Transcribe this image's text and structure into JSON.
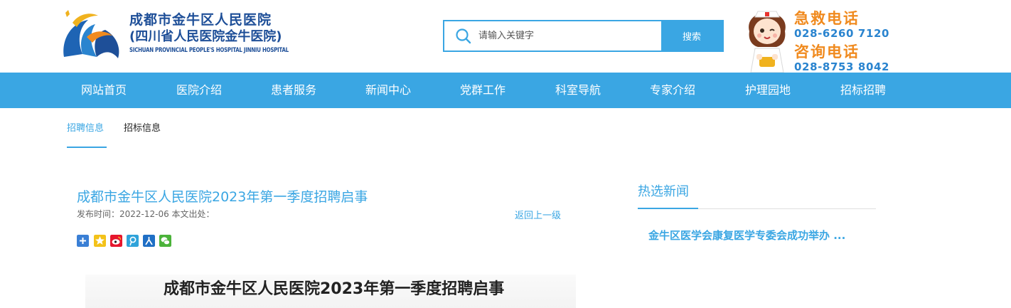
{
  "header": {
    "hospital_name_cn": "成都市金牛区人民医院",
    "hospital_name_cn_sub": "(四川省人民医院金牛医院)",
    "hospital_name_en": "SICHUAN PROVINCIAL PEOPLE'S HOSPITAL JINNIU HOSPITAL",
    "search": {
      "placeholder": "请输入关键字",
      "button_label": "搜索"
    },
    "emergency": {
      "label": "急救电话",
      "number": "028-6260 7120"
    },
    "consult": {
      "label": "咨询电话",
      "number": "028-8753 8042"
    }
  },
  "nav": {
    "items": [
      {
        "label": "网站首页"
      },
      {
        "label": "医院介绍"
      },
      {
        "label": "患者服务"
      },
      {
        "label": "新闻中心"
      },
      {
        "label": "党群工作"
      },
      {
        "label": "科室导航"
      },
      {
        "label": "专家介绍"
      },
      {
        "label": "护理园地"
      },
      {
        "label": "招标招聘"
      }
    ]
  },
  "subtabs": [
    {
      "label": "招聘信息",
      "active": true
    },
    {
      "label": "招标信息",
      "active": false
    }
  ],
  "article": {
    "title": "成都市金牛区人民医院2023年第一季度招聘启事",
    "meta": "发布时间：2022-12-06 本文出处：",
    "back_label": "返回上一级",
    "heading": "成都市金牛区人民医院2023年第一季度招聘启事",
    "share_icons": [
      "share-more-icon",
      "qzone-icon",
      "weibo-icon",
      "tencent-icon",
      "renren-icon",
      "wechat-icon"
    ]
  },
  "sidebar": {
    "title": "热选新闻",
    "news": [
      {
        "title": "金牛区医学会康复医学专委会成功举办 ..."
      }
    ]
  },
  "colors": {
    "accent": "#3aa6e3",
    "brand_dark": "#1e4f98",
    "phone_label": "#f08a1e",
    "phone_number": "#2a84cf"
  }
}
